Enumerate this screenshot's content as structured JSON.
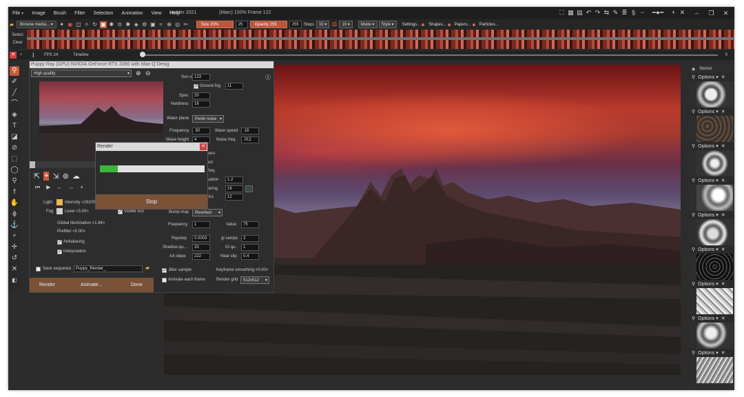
{
  "menu": {
    "items": [
      "File",
      "Image",
      "Brush",
      "Filter",
      "Selection",
      "Animation",
      "View",
      "Help"
    ],
    "app_title": "Howler 2021",
    "doc_title": "(Main)  100%  Frame  122"
  },
  "toolbar": {
    "browse": "Browse media...",
    "size": "Size 25%",
    "size_val": "25",
    "opacity": "Opacity 255",
    "opacity_val": "255",
    "steps_label": "Steps",
    "steps_val": "10",
    "steps2_val": "10",
    "mode": "Mode",
    "style": "Style",
    "settings": "Settings...",
    "shapes": "Shapes...",
    "papers": "Papers...",
    "particles": "Particles..."
  },
  "left_labels": {
    "select": "Select",
    "clear": "Clear"
  },
  "timeline": {
    "fps": "FPS  24",
    "label": "Timeline",
    "end_val": "0"
  },
  "right_panel": {
    "stored": "Stored",
    "options": "Options",
    "count": 9
  },
  "puppy": {
    "title": "Puppy Ray (GPU)  NVIDIA GeForce RTX 2080 with Max-Q Desig",
    "quality": "High quality",
    "sun_size_label": "Sun size",
    "sun_size": "123",
    "ground_fog_label": "Ground fog",
    "ground_fog": "11",
    "spec_label": "Spec",
    "spec": "20",
    "hardness_label": "Hardness",
    "hardness": "16",
    "water_plane_label": "Water plane",
    "water_plane": "Perlin noise",
    "frequency_label": "Frequency",
    "frequency": ".50",
    "wave_speed_label": "Wave speed",
    "wave_speed": ".18",
    "wave_height_label": "Wave height",
    "wave_height": "4",
    "noise_freq_label": "Noise freq.",
    "noise_freq": ".012",
    "partial1": "kers",
    "partial2": "ect",
    "partial3": "freq.",
    "partial4": "uation",
    "partial4_val": "1.2",
    "partial5": "tering",
    "partial5_val": "16",
    "partial6": "tics",
    "partial6_val": "12",
    "bump_label": "Bump map",
    "bump": "Riverbed",
    "freq2_label": "Frequency",
    "freq2": "1",
    "value_label": "Value",
    "value": "75",
    "raystep_label": "Raystep",
    "raystep": "0.0003",
    "gisamps_label": "gi samps",
    "gisamps": "3",
    "shadow_label": "Shadow qu...",
    "shadow": "33",
    "giqu_label": "Gi qu..",
    "giqu": "1",
    "aa_label": "AA steps",
    "aa": "222",
    "near_label": "Near clip",
    "near": "0.4",
    "light_label": "Light",
    "intensity": "Intensity <28100>",
    "fog_label": "Fog",
    "level": "Level <3.00>",
    "visible_sun": "Visible sun",
    "gi": "Global illumination <1.94>",
    "prefilter": "Prefilter <0.00>",
    "antialiasing": "Antialiasing",
    "interpolation": "Interpolation",
    "save_seq": "Save sequence",
    "seq_name": "Puppy_Render_",
    "jitter": "Jitter sample",
    "animate_each": "Animate each frame",
    "kf_smooth": "Keyframe smoothing <0.00>",
    "render_grid_label": "Render grid",
    "render_grid": "512x512",
    "btn_render": "Render",
    "btn_animate": "Animate...",
    "btn_done": "Done"
  },
  "render_dialog": {
    "title": "Render",
    "progress": 0.17,
    "stop": "Stop"
  }
}
